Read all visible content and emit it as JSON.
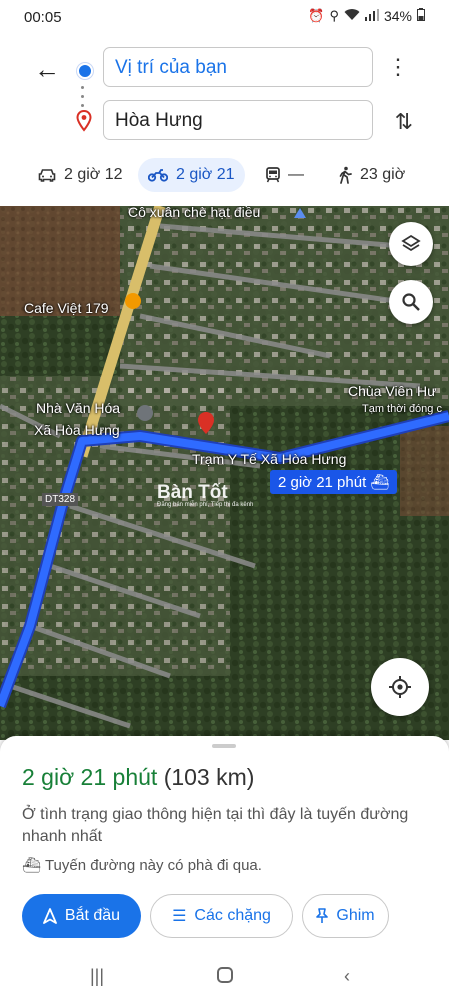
{
  "status": {
    "time": "00:05",
    "battery": "34%"
  },
  "search": {
    "origin": "Vị trí của bạn",
    "destination": "Hòa Hưng"
  },
  "modes": [
    {
      "icon": "car-icon",
      "label": "2 giờ 12",
      "selected": false
    },
    {
      "icon": "motorbike-icon",
      "label": "2 giờ 21",
      "selected": true
    },
    {
      "icon": "transit-icon",
      "label": "—",
      "selected": false
    },
    {
      "icon": "walk-icon",
      "label": "23 giờ",
      "selected": false
    }
  ],
  "map": {
    "labels": {
      "poi_top": "Cô xuân chè hạt điều",
      "cafe": "Cafe Việt 179",
      "pagoda": "Chùa Viên Hư",
      "pagoda_note": "Tạm thời đóng c",
      "culture_house_1": "Nhà Văn Hóa",
      "culture_house_2": "Xã Hòa Hưng",
      "health_station": "Trạm Y Tế Xã Hòa Hưng",
      "road": "DT328"
    },
    "route_badge": "2 giờ 21 phút",
    "watermark": "Bàn Tốt",
    "watermark_sub": "Đăng bán miễn phí, Tiếp thị đa kênh"
  },
  "sheet": {
    "duration": "2 giờ 21 phút",
    "distance": "(103 km)",
    "description": "Ở tình trạng giao thông hiện tại thì đây là tuyến đường nhanh nhất",
    "ferry_note": "Tuyến đường này có phà đi qua.",
    "start_label": "Bắt đầu",
    "steps_label": "Các chặng",
    "pin_label": "Ghim"
  },
  "colors": {
    "accent": "#1a73e8",
    "eta": "#188038",
    "route": "#1a56e8"
  }
}
